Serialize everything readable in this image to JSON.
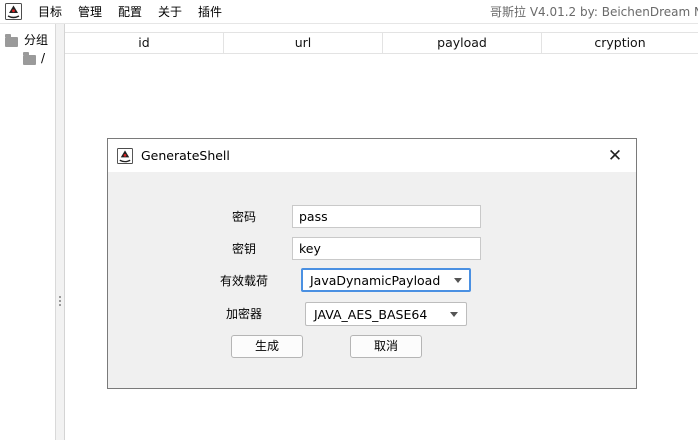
{
  "menu": {
    "items": [
      "目标",
      "管理",
      "配置",
      "关于",
      "插件"
    ],
    "app_icon": "java-duke-icon",
    "title": "哥斯拉   V4.01.2 by: BeichenDream  N"
  },
  "tree": {
    "root_label": "分组",
    "child_label": "/"
  },
  "table": {
    "columns": [
      "id",
      "url",
      "payload",
      "cryption"
    ]
  },
  "dialog": {
    "title": "GenerateShell",
    "icon": "java-duke-icon",
    "close_icon": "close-icon",
    "password_label": "密码",
    "password_value": "pass",
    "key_label": "密钥",
    "key_value": "key",
    "payload_label": "有效载荷",
    "payload_value": "JavaDynamicPayload",
    "cryption_label": "加密器",
    "cryption_value": "JAVA_AES_BASE64",
    "generate_label": "生成",
    "cancel_label": "取消"
  },
  "colors": {
    "focus_border": "#4a90e2",
    "dialog_bg": "#f0f0f0"
  }
}
